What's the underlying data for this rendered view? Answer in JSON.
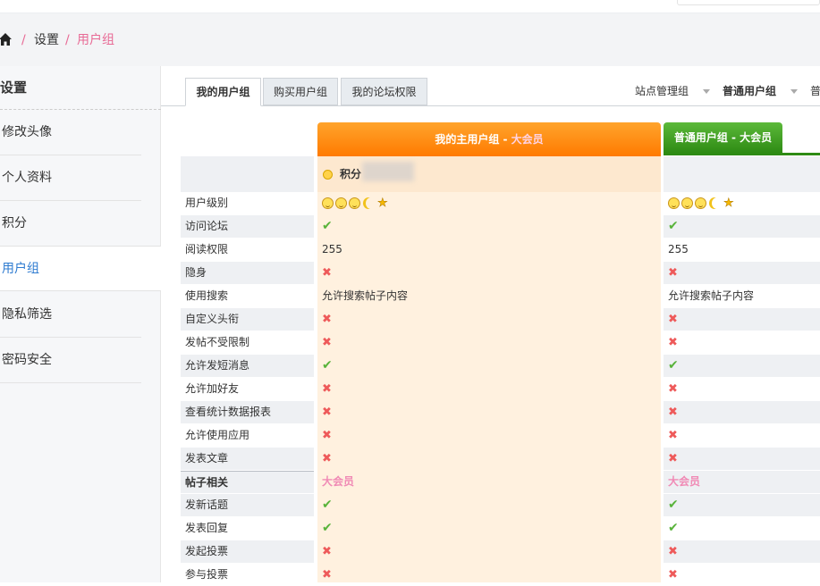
{
  "breadcrumb": {
    "sep": "/",
    "items": [
      "设置",
      "用户组"
    ]
  },
  "sidebar": {
    "title": "设置",
    "items": [
      {
        "label": "修改头像"
      },
      {
        "label": "个人资料"
      },
      {
        "label": "积分"
      },
      {
        "label": "用户组",
        "active": true
      },
      {
        "label": "隐私筛选"
      },
      {
        "label": "密码安全"
      }
    ]
  },
  "tabs": [
    {
      "label": "我的用户组",
      "active": true
    },
    {
      "label": "购买用户组"
    },
    {
      "label": "我的论坛权限"
    }
  ],
  "group_switch": [
    "站点管理组",
    "普通用户组",
    "普"
  ],
  "columns": {
    "main": {
      "title": "我的主用户组",
      "sep": " - ",
      "level": "大会员"
    },
    "other": {
      "title": "普通用户组",
      "sep": " - ",
      "level": "大会员"
    }
  },
  "score_label": "积分",
  "rows": [
    {
      "label": "用户级别",
      "type": "level"
    },
    {
      "label": "访问论坛",
      "v1": "✔",
      "v2": "✔"
    },
    {
      "label": "阅读权限",
      "v1": "255",
      "v2": "255"
    },
    {
      "label": "隐身",
      "v1": "✖",
      "v2": "✖"
    },
    {
      "label": "使用搜索",
      "v1": "允许搜索帖子内容",
      "v2": "允许搜索帖子内容"
    },
    {
      "label": "自定义头衔",
      "v1": "✖",
      "v2": "✖"
    },
    {
      "label": "发帖不受限制",
      "v1": "✖",
      "v2": "✖"
    },
    {
      "label": "允许发短消息",
      "v1": "✔",
      "v2": "✔"
    },
    {
      "label": "允许加好友",
      "v1": "✖",
      "v2": "✖"
    },
    {
      "label": "查看统计数据报表",
      "v1": "✖",
      "v2": "✖"
    },
    {
      "label": "允许使用应用",
      "v1": "✖",
      "v2": "✖"
    },
    {
      "label": "发表文章",
      "v1": "✖",
      "v2": "✖"
    },
    {
      "label": "帖子相关",
      "v1": "大会员",
      "v2": "大会员",
      "section": true
    },
    {
      "label": "发新话题",
      "v1": "✔",
      "v2": "✔"
    },
    {
      "label": "发表回复",
      "v1": "✔",
      "v2": "✔"
    },
    {
      "label": "发起投票",
      "v1": "✖",
      "v2": "✖"
    },
    {
      "label": "参与投票",
      "v1": "✖",
      "v2": "✖"
    }
  ],
  "colors": {
    "accent": "#e86a95",
    "orange": "#ff7a00",
    "green": "#2e8b14",
    "ok": "#58b33a",
    "no": "#ee5a5a"
  }
}
